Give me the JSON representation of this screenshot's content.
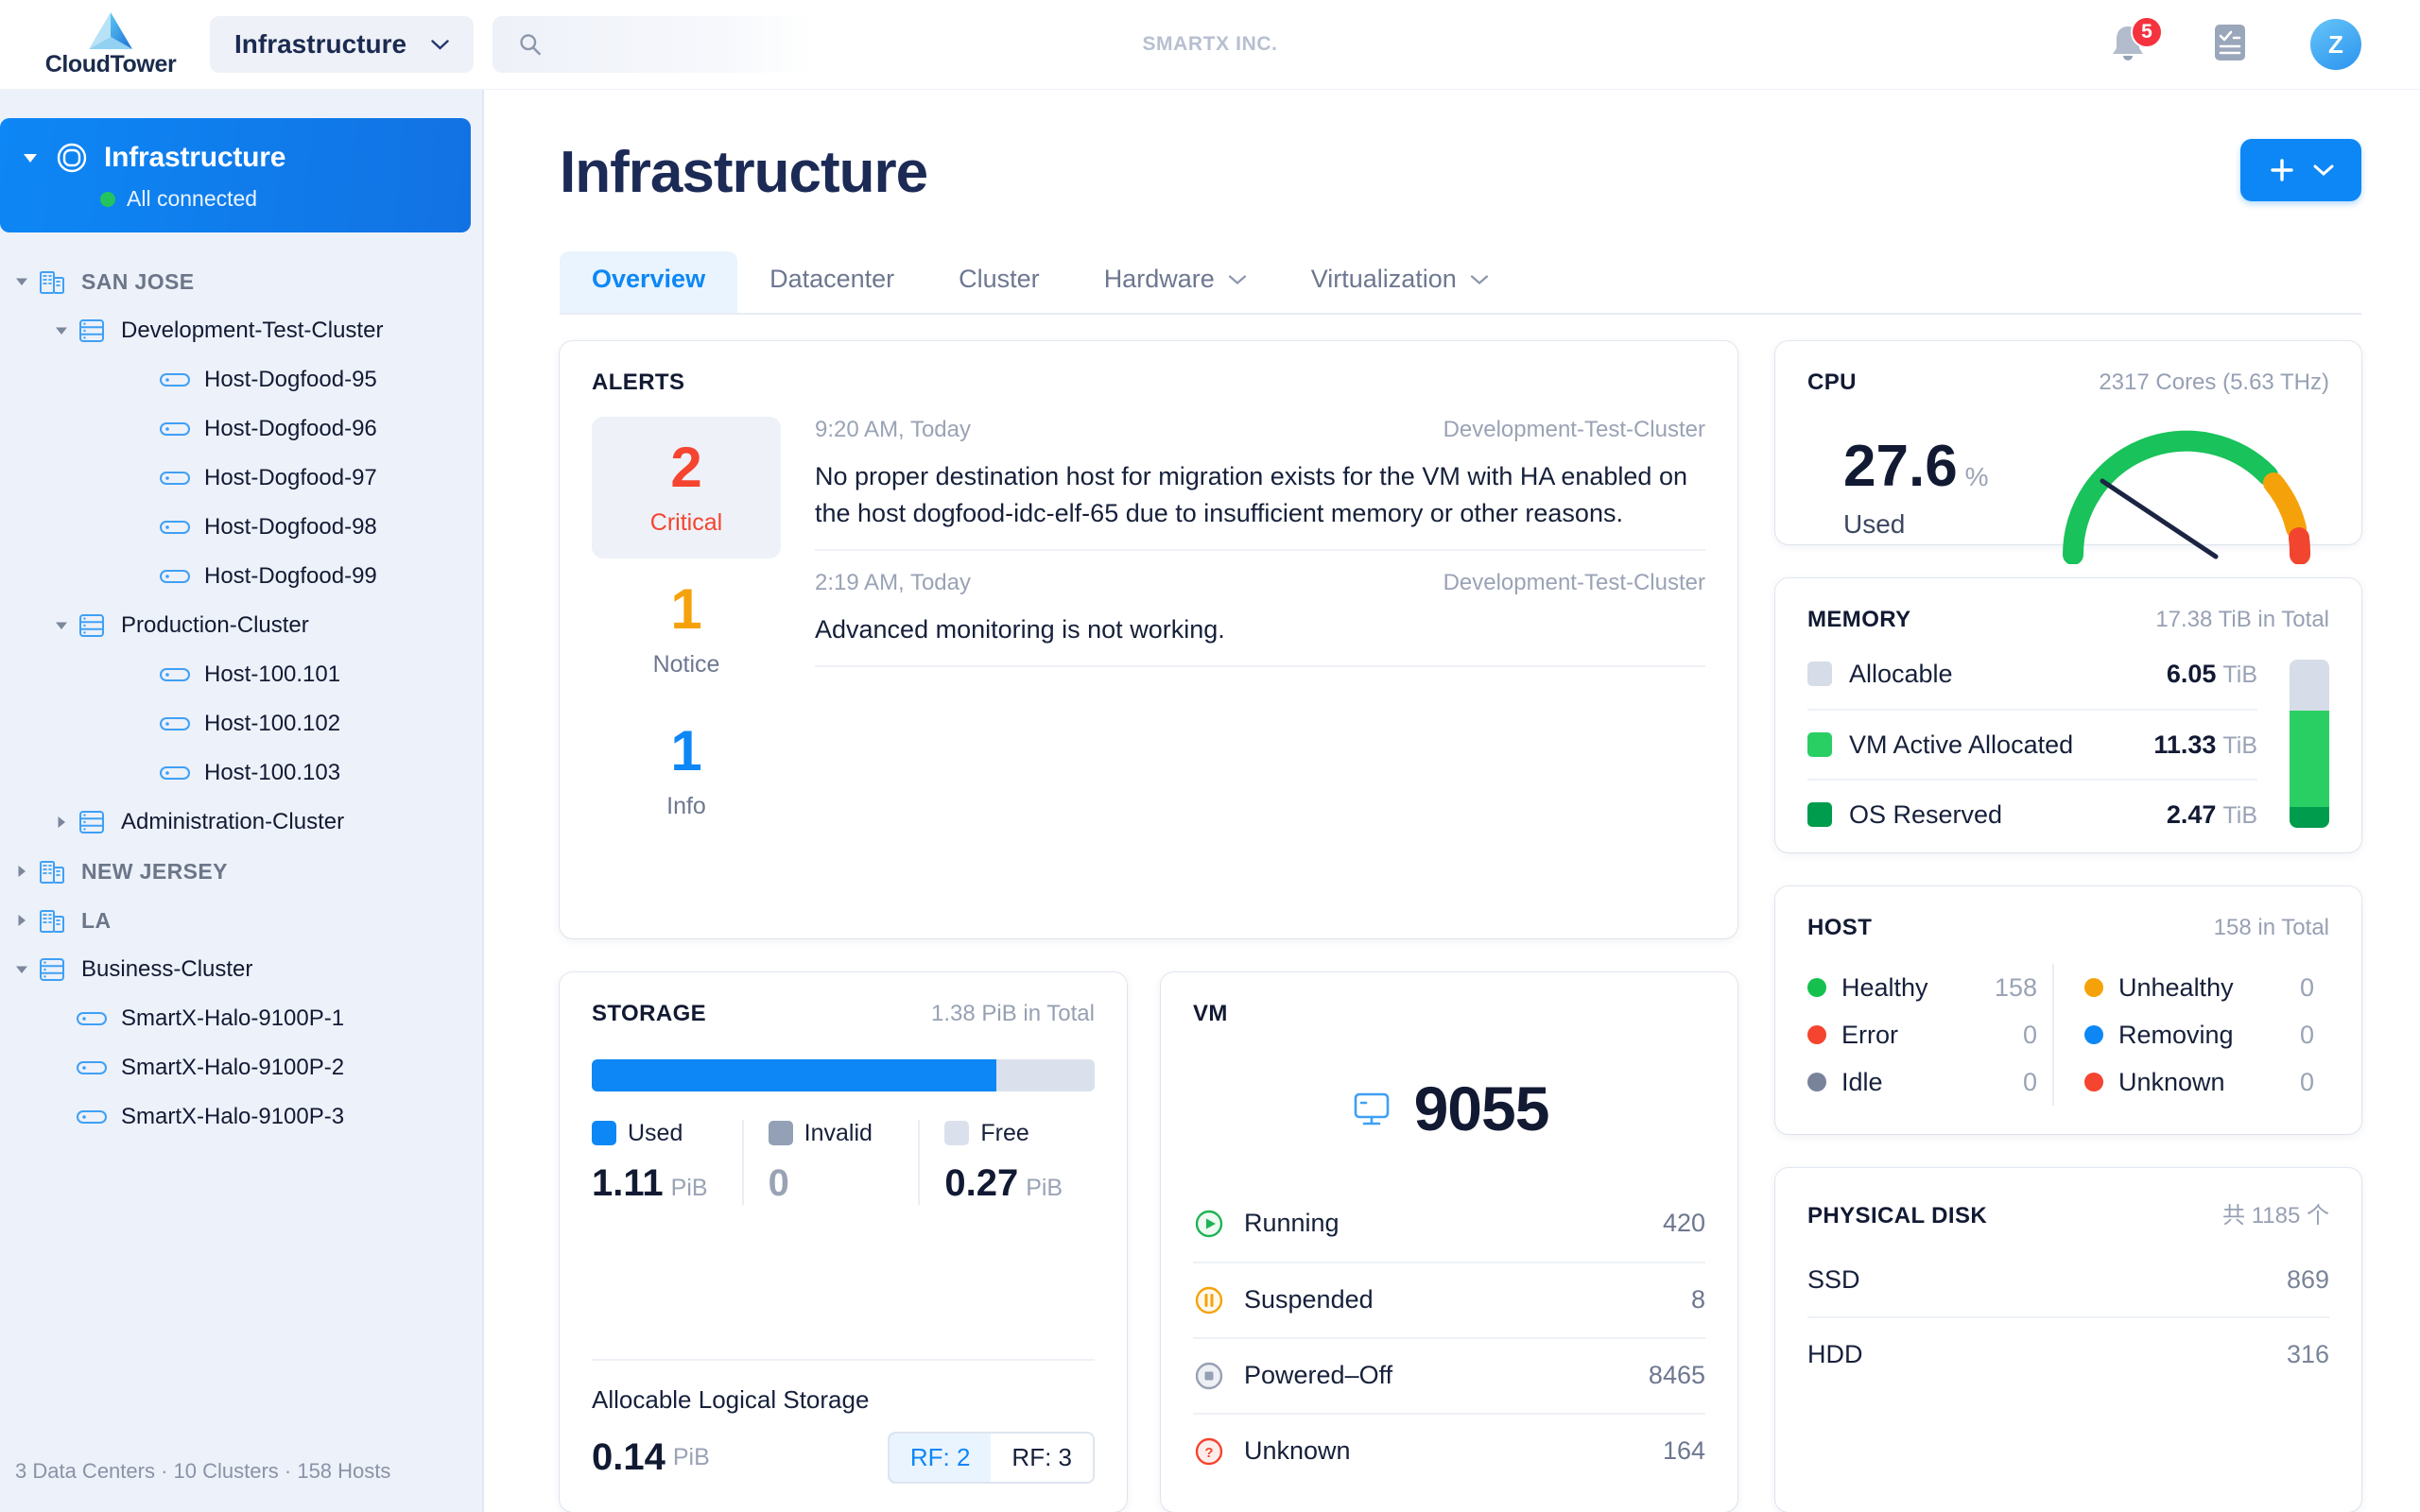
{
  "header": {
    "brand_name": "CloudTower",
    "module_label": "Infrastructure",
    "search_placeholder": "",
    "tenant": "SMARTX INC.",
    "notification_count": "5",
    "avatar_initial": "Z"
  },
  "sidebar": {
    "root": {
      "title": "Infrastructure",
      "status": "All connected"
    },
    "nodes": [
      {
        "level": 0,
        "type": "datacenter",
        "label": "SAN JOSE",
        "expanded": true
      },
      {
        "level": 1,
        "type": "cluster",
        "label": "Development-Test-Cluster",
        "expanded": true
      },
      {
        "level": 2,
        "type": "host",
        "label": "Host-Dogfood-95"
      },
      {
        "level": 2,
        "type": "host",
        "label": "Host-Dogfood-96"
      },
      {
        "level": 2,
        "type": "host",
        "label": "Host-Dogfood-97"
      },
      {
        "level": 2,
        "type": "host",
        "label": "Host-Dogfood-98"
      },
      {
        "level": 2,
        "type": "host",
        "label": "Host-Dogfood-99"
      },
      {
        "level": 1,
        "type": "cluster",
        "label": "Production-Cluster",
        "expanded": true
      },
      {
        "level": 2,
        "type": "host",
        "label": "Host-100.101"
      },
      {
        "level": 2,
        "type": "host",
        "label": "Host-100.102"
      },
      {
        "level": 2,
        "type": "host",
        "label": "Host-100.103"
      },
      {
        "level": 1,
        "type": "cluster",
        "label": "Administration-Cluster",
        "expanded": false
      },
      {
        "level": 0,
        "type": "datacenter",
        "label": "NEW JERSEY",
        "expanded": false
      },
      {
        "level": 0,
        "type": "datacenter",
        "label": "LA",
        "expanded": false
      },
      {
        "level": 0,
        "type": "cluster",
        "label": "Business-Cluster",
        "expanded": true
      },
      {
        "level": 1,
        "type": "host",
        "label": "SmartX-Halo-9100P-1"
      },
      {
        "level": 1,
        "type": "host",
        "label": "SmartX-Halo-9100P-2"
      },
      {
        "level": 1,
        "type": "host",
        "label": "SmartX-Halo-9100P-3"
      }
    ],
    "footer": "3 Data Centers  ·  10 Clusters  ·  158 Hosts"
  },
  "main": {
    "page_title": "Infrastructure",
    "tabs": [
      {
        "label": "Overview",
        "active": true,
        "dropdown": false
      },
      {
        "label": "Datacenter",
        "active": false,
        "dropdown": false
      },
      {
        "label": "Cluster",
        "active": false,
        "dropdown": false
      },
      {
        "label": "Hardware",
        "active": false,
        "dropdown": true
      },
      {
        "label": "Virtualization",
        "active": false,
        "dropdown": true
      }
    ]
  },
  "alerts": {
    "title": "ALERTS",
    "counts": [
      {
        "value": "2",
        "label": "Critical",
        "selected": true
      },
      {
        "value": "1",
        "label": "Notice",
        "selected": false
      },
      {
        "value": "1",
        "label": "Info",
        "selected": false
      }
    ],
    "items": [
      {
        "time": "9:20 AM, Today",
        "source": "Development-Test-Cluster",
        "message": "No proper destination host for migration exists for the VM with HA enabled on the host dogfood-idc-elf-65 due to insufficient memory or other reasons."
      },
      {
        "time": "2:19 AM, Today",
        "source": "Development-Test-Cluster",
        "message": "Advanced monitoring is not working."
      }
    ]
  },
  "cpu": {
    "title": "CPU",
    "meta": "2317 Cores (5.63 THz)",
    "value": "27.6",
    "unit": "%",
    "caption": "Used"
  },
  "memory": {
    "title": "MEMORY",
    "meta": "17.38 TiB in Total",
    "rows": [
      {
        "label": "Allocable",
        "value": "6.05",
        "unit": "TiB",
        "color": "#d6dce8"
      },
      {
        "label": "VM Active Allocated",
        "value": "11.33",
        "unit": "TiB",
        "color": "#29cf63"
      },
      {
        "label": "OS Reserved",
        "value": "2.47",
        "unit": "TiB",
        "color": "#009c4d"
      }
    ]
  },
  "storage": {
    "title": "STORAGE",
    "meta": "1.38 PiB in Total",
    "legend": [
      {
        "label": "Used",
        "value": "1.11",
        "unit": "PiB",
        "color": "#0d87f5"
      },
      {
        "label": "Invalid",
        "value": "0",
        "unit": "",
        "color": "#93a0b5"
      },
      {
        "label": "Free",
        "value": "0.27",
        "unit": "PiB",
        "color": "#dbe1ec"
      }
    ],
    "allocable_label": "Allocable Logical Storage",
    "allocable_value": "0.14",
    "allocable_unit": "PiB",
    "rf_options": [
      {
        "label": "RF: 2",
        "selected": true
      },
      {
        "label": "RF: 3",
        "selected": false
      }
    ]
  },
  "vm": {
    "title": "VM",
    "total": "9055",
    "rows": [
      {
        "label": "Running",
        "count": "420",
        "icon": "play-circle-icon",
        "color": "#1fb356"
      },
      {
        "label": "Suspended",
        "count": "8",
        "icon": "pause-circle-icon",
        "color": "#f5a20a"
      },
      {
        "label": "Powered–Off",
        "count": "8465",
        "icon": "stop-circle-icon",
        "color": "#97a0b3"
      },
      {
        "label": "Unknown",
        "count": "164",
        "icon": "question-circle-icon",
        "color": "#f5442f"
      }
    ]
  },
  "host": {
    "title": "HOST",
    "meta": "158 in Total",
    "left": [
      {
        "label": "Healthy",
        "count": "158",
        "color": "#15c04f"
      },
      {
        "label": "Error",
        "count": "0",
        "color": "#f5442f"
      },
      {
        "label": "Idle",
        "count": "0",
        "color": "#78839a"
      }
    ],
    "right": [
      {
        "label": "Unhealthy",
        "count": "0",
        "color": "#f5a20a"
      },
      {
        "label": "Removing",
        "count": "0",
        "color": "#0d87f5"
      },
      {
        "label": "Unknown",
        "count": "0",
        "color": "#f5442f"
      }
    ]
  },
  "physical_disk": {
    "title": "PHYSICAL DISK",
    "meta": "共 1185 个",
    "rows": [
      {
        "label": "SSD",
        "count": "869"
      },
      {
        "label": "HDD",
        "count": "316"
      }
    ]
  },
  "chart_data": [
    {
      "type": "gauge",
      "title": "CPU Used",
      "value": 27.6,
      "unit": "%",
      "range": [
        0,
        100
      ],
      "bands": [
        {
          "from": 0,
          "to": 80,
          "color": "#19c25a"
        },
        {
          "from": 80,
          "to": 94,
          "color": "#f5a20a"
        },
        {
          "from": 94,
          "to": 100,
          "color": "#f5442f"
        }
      ]
    },
    {
      "type": "bar",
      "title": "MEMORY",
      "categories": [
        "Allocable",
        "VM Active Allocated",
        "OS Reserved"
      ],
      "values": [
        6.05,
        11.33,
        2.47
      ],
      "ylabel": "TiB",
      "total": 17.38,
      "stacked": true,
      "colors": [
        "#d6dce8",
        "#29cf63",
        "#009c4d"
      ]
    },
    {
      "type": "bar",
      "title": "STORAGE",
      "categories": [
        "Used",
        "Invalid",
        "Free"
      ],
      "values": [
        1.11,
        0,
        0.27
      ],
      "ylabel": "PiB",
      "total": 1.38,
      "stacked": true,
      "colors": [
        "#0d87f5",
        "#93a0b5",
        "#dbe1ec"
      ]
    },
    {
      "type": "table",
      "title": "VM",
      "categories": [
        "Running",
        "Suspended",
        "Powered–Off",
        "Unknown"
      ],
      "values": [
        420,
        8,
        8465,
        164
      ],
      "total": 9055
    },
    {
      "type": "table",
      "title": "HOST",
      "categories": [
        "Healthy",
        "Error",
        "Idle",
        "Unhealthy",
        "Removing",
        "Unknown"
      ],
      "values": [
        158,
        0,
        0,
        0,
        0,
        0
      ],
      "total": 158
    },
    {
      "type": "table",
      "title": "PHYSICAL DISK",
      "categories": [
        "SSD",
        "HDD"
      ],
      "values": [
        869,
        316
      ],
      "total": 1185
    }
  ]
}
